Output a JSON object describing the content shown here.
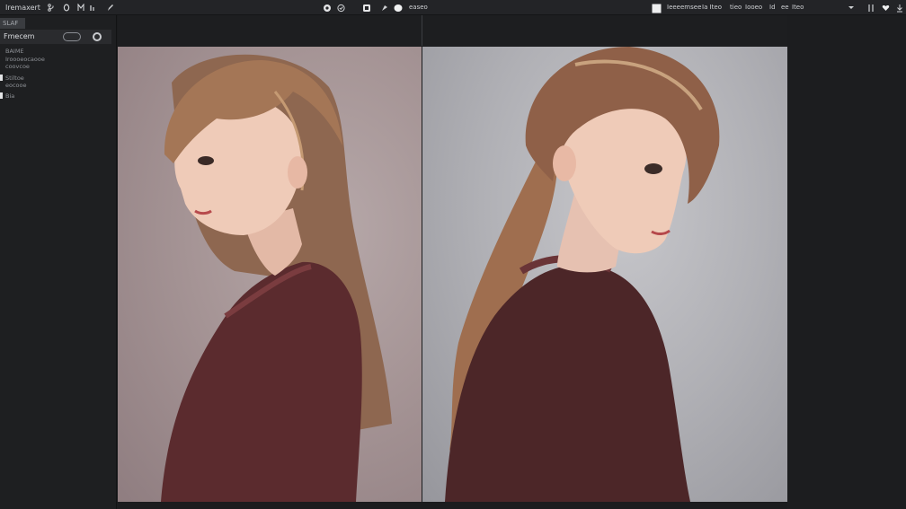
{
  "topbar": {
    "app_title": "Iremaxert",
    "left_icons": [
      "branch-icon",
      "circle-icon",
      "letter-m-icon",
      "bars-icon",
      "pen-icon"
    ],
    "center_icons": [
      "settings-icon",
      "check-icon",
      "frame-icon",
      "pin-icon",
      "brush-icon"
    ],
    "center_label": "easeo",
    "right_labels": [
      "Ieeeemsee",
      "Ia Iteo",
      "tieo",
      "Iooeo",
      "Id",
      "ee",
      "Iteo"
    ],
    "right_icons": [
      "dropdown-icon",
      "split-icon",
      "heart-icon",
      "download-icon"
    ]
  },
  "sidebar": {
    "tag": "SLAF",
    "title": "Fmecem",
    "lines": [
      {
        "text": "BAIME"
      },
      {
        "text": "Iroooeocaooe"
      },
      {
        "text": "coovcoe"
      },
      {
        "text": "Stiltoe"
      },
      {
        "text": "eocooe"
      },
      {
        "text": "Bia"
      }
    ]
  },
  "images": {
    "left": {
      "label": "left-comparison-image"
    },
    "right": {
      "label": "right-comparison-image"
    }
  },
  "colors": {
    "topbar": "#232427",
    "sidebar": "#1e1f21",
    "left_bg": "#a69596",
    "right_bg": "#b0b0b5",
    "sweater": "#5b2b2e",
    "hair": "#a47656",
    "skin": "#efcbb8"
  }
}
